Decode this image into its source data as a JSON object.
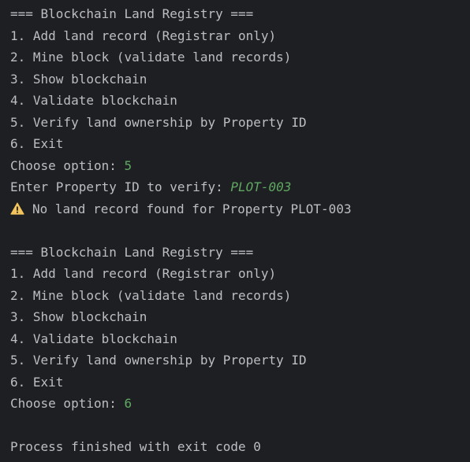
{
  "output": {
    "block1": {
      "header": "=== Blockchain Land Registry ===",
      "menu": [
        "1. Add land record (Registrar only)",
        "2. Mine block (validate land records)",
        "3. Show blockchain",
        "4. Validate blockchain",
        "5. Verify land ownership by Property ID",
        "6. Exit"
      ],
      "prompt": "Choose option: ",
      "choice": "5",
      "verify_prompt": "Enter Property ID to verify: ",
      "property_id": "PLOT-003",
      "warning_icon": "warning-triangle-icon",
      "warning_text": "No land record found for Property PLOT-003"
    },
    "block2": {
      "header": "=== Blockchain Land Registry ===",
      "menu": [
        "1. Add land record (Registrar only)",
        "2. Mine block (validate land records)",
        "3. Show blockchain",
        "4. Validate blockchain",
        "5. Verify land ownership by Property ID",
        "6. Exit"
      ],
      "prompt": "Choose option: ",
      "choice": "6"
    },
    "exit_message": "Process finished with exit code 0"
  },
  "colors": {
    "background": "#1e1f22",
    "text": "#bcbec4",
    "user_input": "#5fa861",
    "warning": "#f2c55c"
  }
}
